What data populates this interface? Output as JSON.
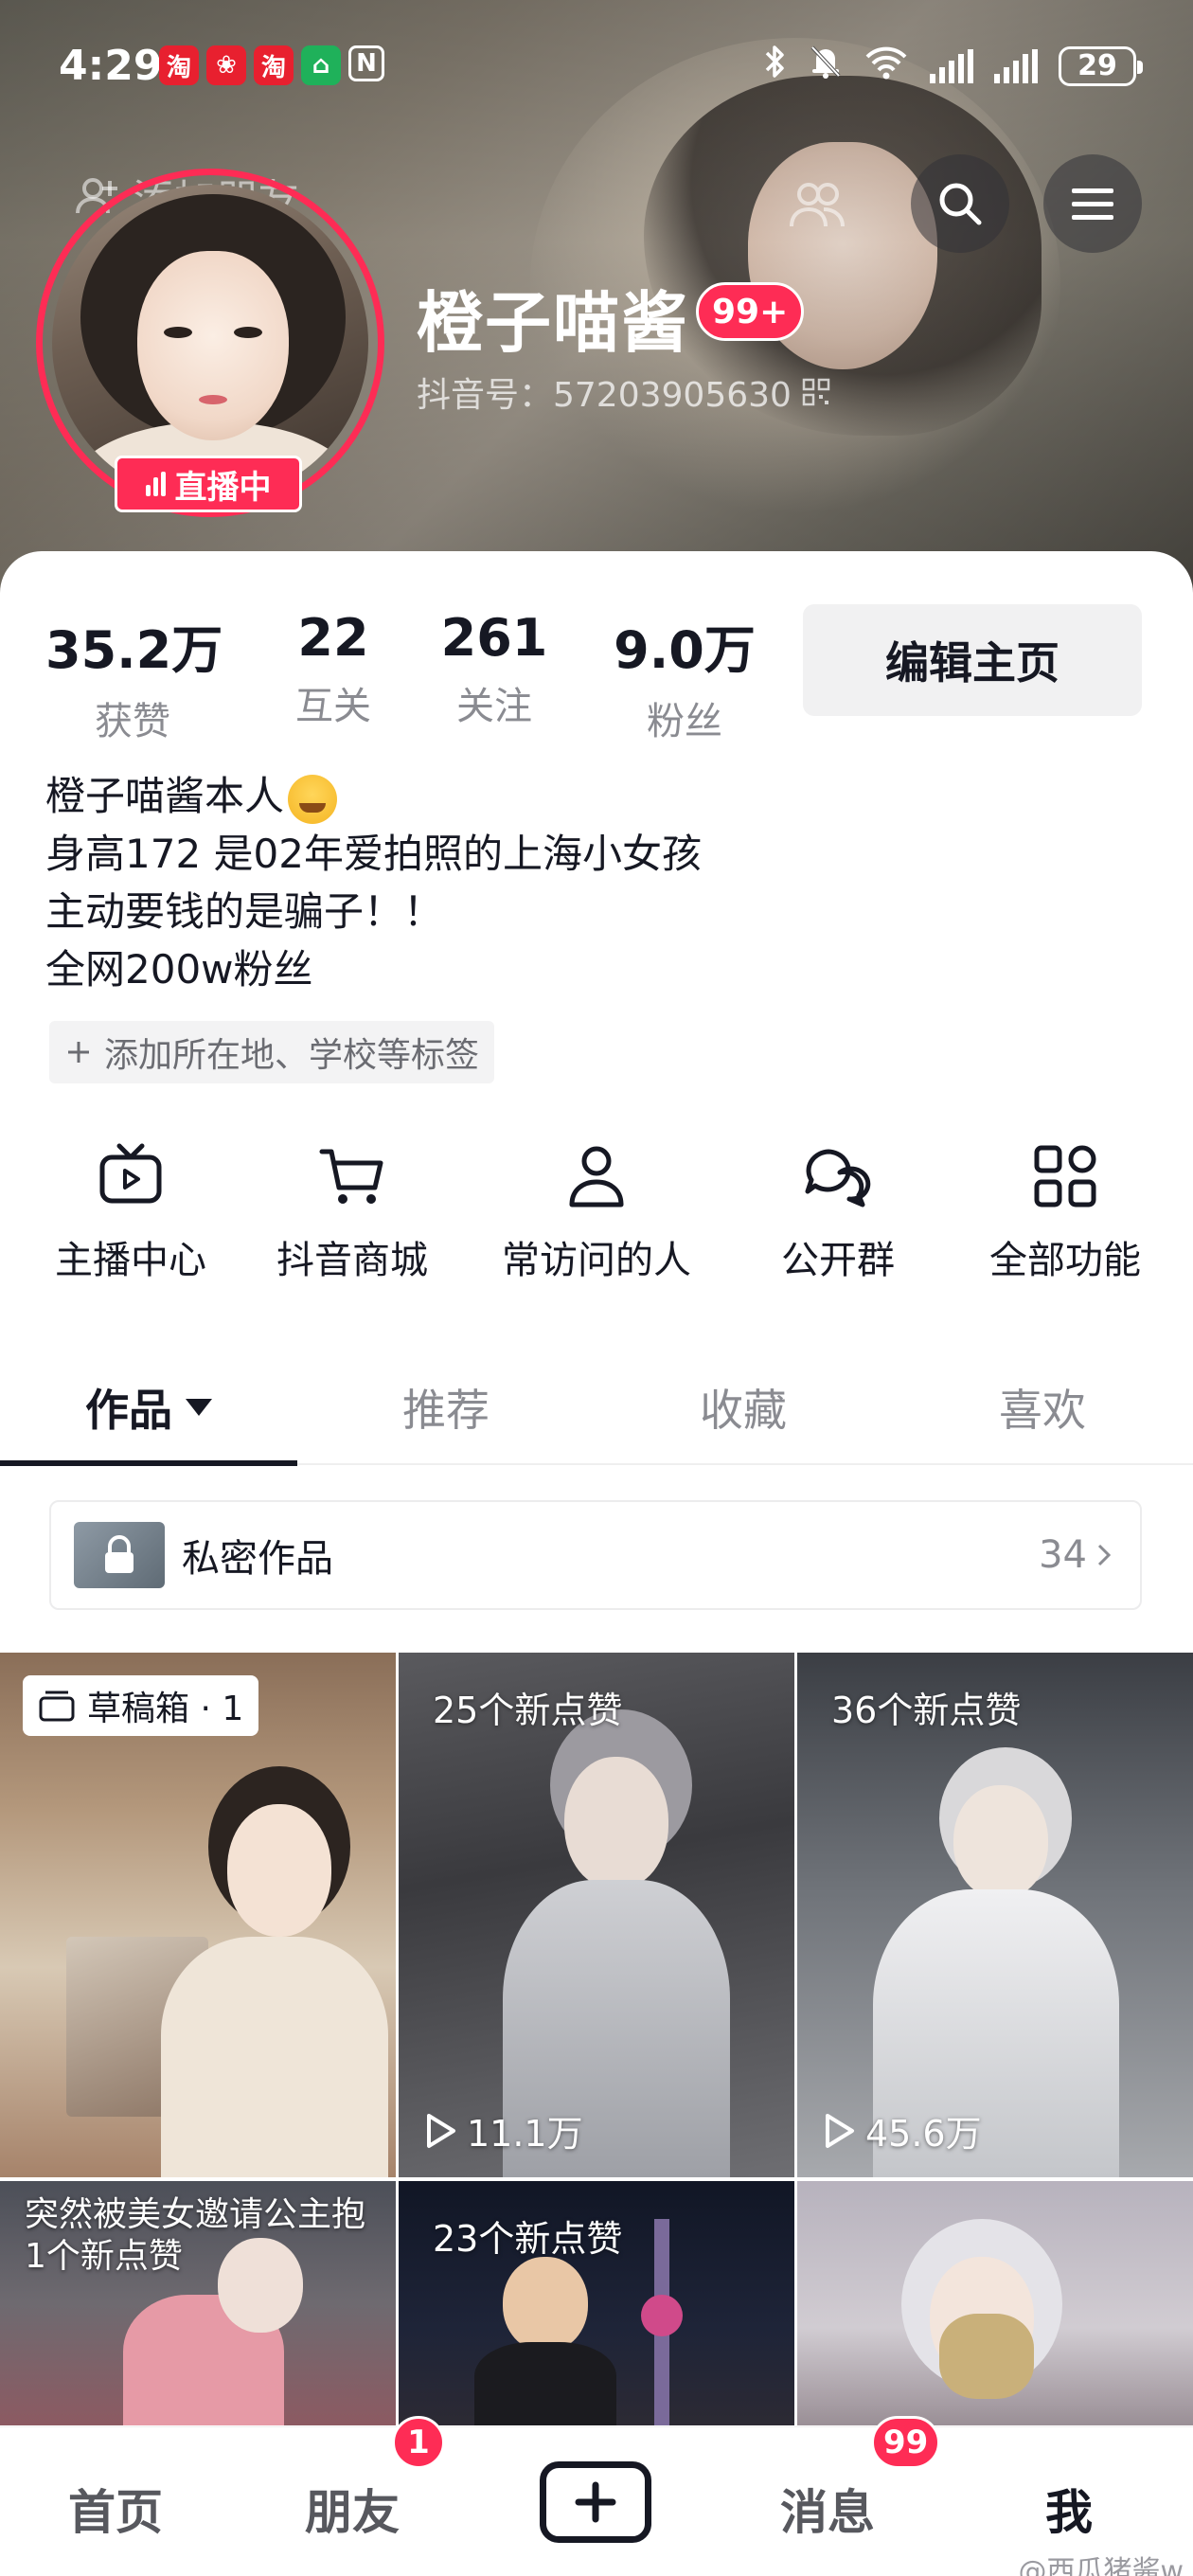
{
  "status_bar": {
    "time": "4:29",
    "battery": "29",
    "app_icons": [
      "taobao-icon",
      "pinduoduo-icon",
      "taobao-icon",
      "home-app-icon",
      "nfc-icon"
    ]
  },
  "header": {
    "add_friend_label": "添加朋友",
    "nickname": "橙子喵酱",
    "nickname_badge": "99+",
    "douyin_id": "抖音号：57203905630",
    "live_badge": "直播中"
  },
  "stats": [
    {
      "value": "35.2万",
      "label": "获赞"
    },
    {
      "value": "22",
      "label": "互关"
    },
    {
      "value": "261",
      "label": "关注"
    },
    {
      "value": "9.0万",
      "label": "粉丝"
    }
  ],
  "edit_profile_label": "编辑主页",
  "bio": {
    "line1": "橙子喵酱本人",
    "line2": "身高172 是02年爱拍照的上海小女孩",
    "line3": "主动要钱的是骗子！！",
    "line4": "全网200w粉丝"
  },
  "add_tag_label": "添加所在地、学校等标签",
  "quick_actions": [
    {
      "label": "主播中心",
      "icon": "tv-icon"
    },
    {
      "label": "抖音商城",
      "icon": "cart-icon"
    },
    {
      "label": "常访问的人",
      "icon": "person-icon"
    },
    {
      "label": "公开群",
      "icon": "chat-group-icon"
    },
    {
      "label": "全部功能",
      "icon": "grid-icon"
    }
  ],
  "tabs": [
    {
      "label": "作品",
      "active": true
    },
    {
      "label": "推荐",
      "active": false
    },
    {
      "label": "收藏",
      "active": false
    },
    {
      "label": "喜欢",
      "active": false
    }
  ],
  "private_works": {
    "label": "私密作品",
    "count": "34"
  },
  "grid": {
    "draft_label": "草稿箱 · 1",
    "tiles": [
      {
        "likes": "",
        "plays": ""
      },
      {
        "likes": "25个新点赞",
        "plays": "11.1万"
      },
      {
        "likes": "36个新点赞",
        "plays": "45.6万"
      },
      {
        "caption": "突然被美女邀请公主抱",
        "likes": "1个新点赞"
      },
      {
        "likes": "23个新点赞"
      },
      {
        "likes": ""
      }
    ]
  },
  "bottom_nav": {
    "home": "首页",
    "friends": "朋友",
    "friends_badge": "1",
    "messages": "消息",
    "messages_badge": "99",
    "me": "我"
  },
  "watermark": "@西瓜猪酱w"
}
